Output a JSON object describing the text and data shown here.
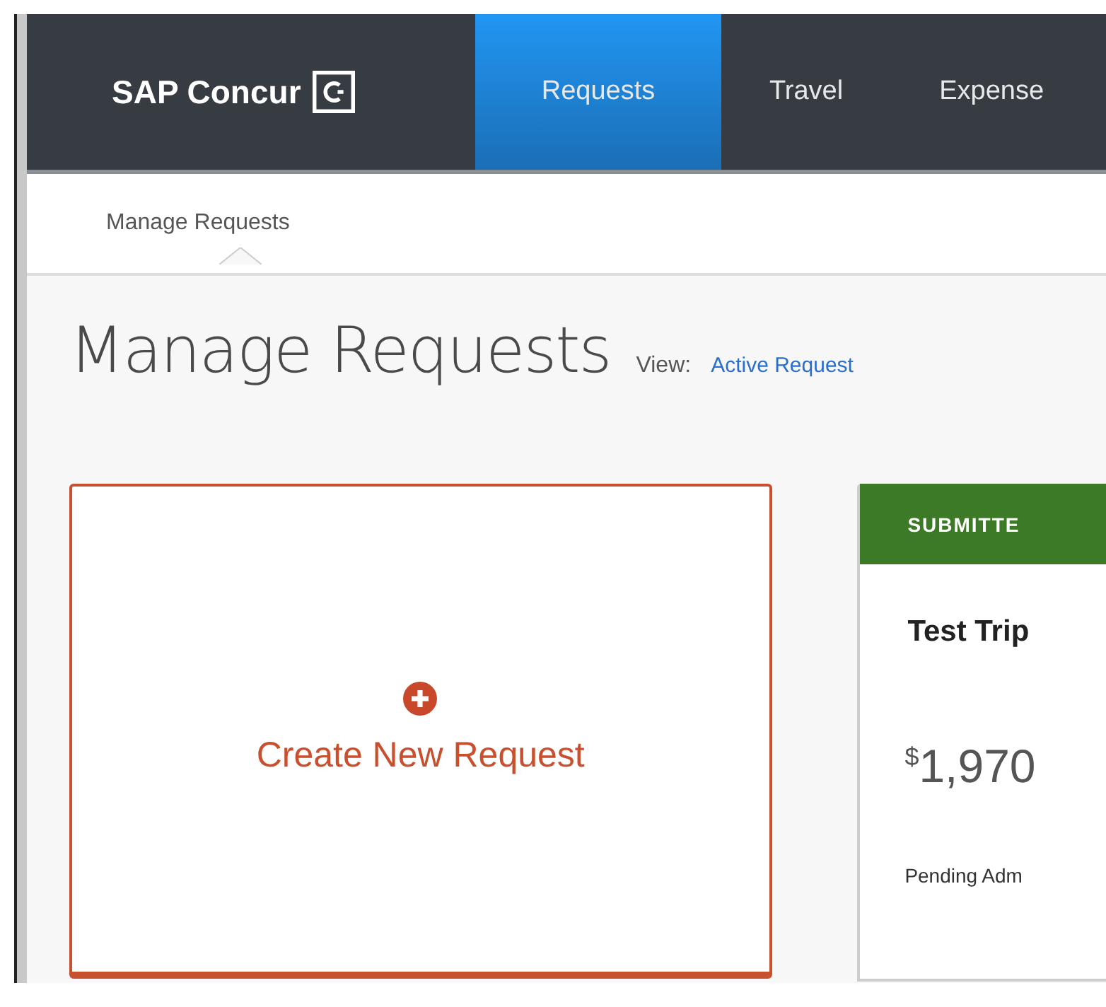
{
  "brand": {
    "name": "SAP Concur"
  },
  "nav": [
    {
      "label": "Requests",
      "selected": true
    },
    {
      "label": "Travel",
      "selected": false
    },
    {
      "label": "Expense",
      "selected": false
    }
  ],
  "subnav": {
    "label": "Manage Requests"
  },
  "page": {
    "title": "Manage Requests",
    "view_label": "View:",
    "view_value": "Active Request"
  },
  "create_card": {
    "label": "Create New Request"
  },
  "requests": [
    {
      "status": "SUBMITTE",
      "name": "Test Trip",
      "amount_symbol": "$",
      "amount": "1,970",
      "note": "Pending Adm"
    }
  ]
}
